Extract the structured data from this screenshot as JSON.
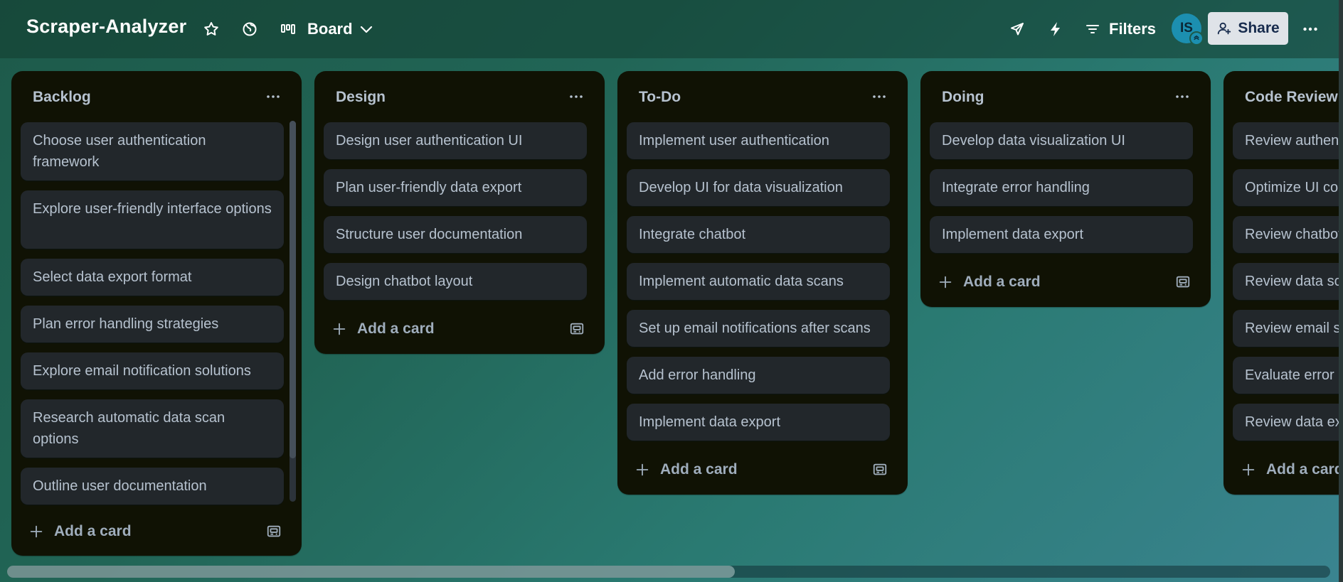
{
  "header": {
    "board_title": "Scraper-Analyzer",
    "view_label": "Board",
    "filters_label": "Filters",
    "avatar_initials": "IS",
    "share_label": "Share"
  },
  "lists": [
    {
      "title": "Backlog",
      "cards": [
        "Choose user authentication framework",
        "Explore user-friendly interface options",
        "Select data export format",
        "Plan error handling strategies",
        "Explore email notification solutions",
        "Research automatic data scan options",
        "Outline user documentation"
      ],
      "add_label": "Add a card"
    },
    {
      "title": "Design",
      "cards": [
        "Design user authentication UI",
        "Plan user-friendly data export",
        "Structure user documentation",
        "Design chatbot layout"
      ],
      "add_label": "Add a card"
    },
    {
      "title": "To-Do",
      "cards": [
        "Implement user authentication",
        "Develop UI for data visualization",
        "Integrate chatbot",
        "Implement automatic data scans",
        "Set up email notifications after scans",
        "Add error handling",
        "Implement data export"
      ],
      "add_label": "Add a card"
    },
    {
      "title": "Doing",
      "cards": [
        "Develop data visualization UI",
        "Integrate error handling",
        "Implement data export"
      ],
      "add_label": "Add a card"
    },
    {
      "title": "Code Review",
      "cards": [
        "Review authentication",
        "Optimize UI code",
        "Review chatbot",
        "Review data scans",
        "Review email setup",
        "Evaluate error handling",
        "Review data export"
      ],
      "add_label": "Add a card"
    }
  ],
  "colors": {
    "list_bg": "#101204",
    "card_bg": "#22272b",
    "text": "#b6c2cf",
    "share_bg": "#dfe3e8",
    "avatar_bg": "#1c8fb0"
  }
}
